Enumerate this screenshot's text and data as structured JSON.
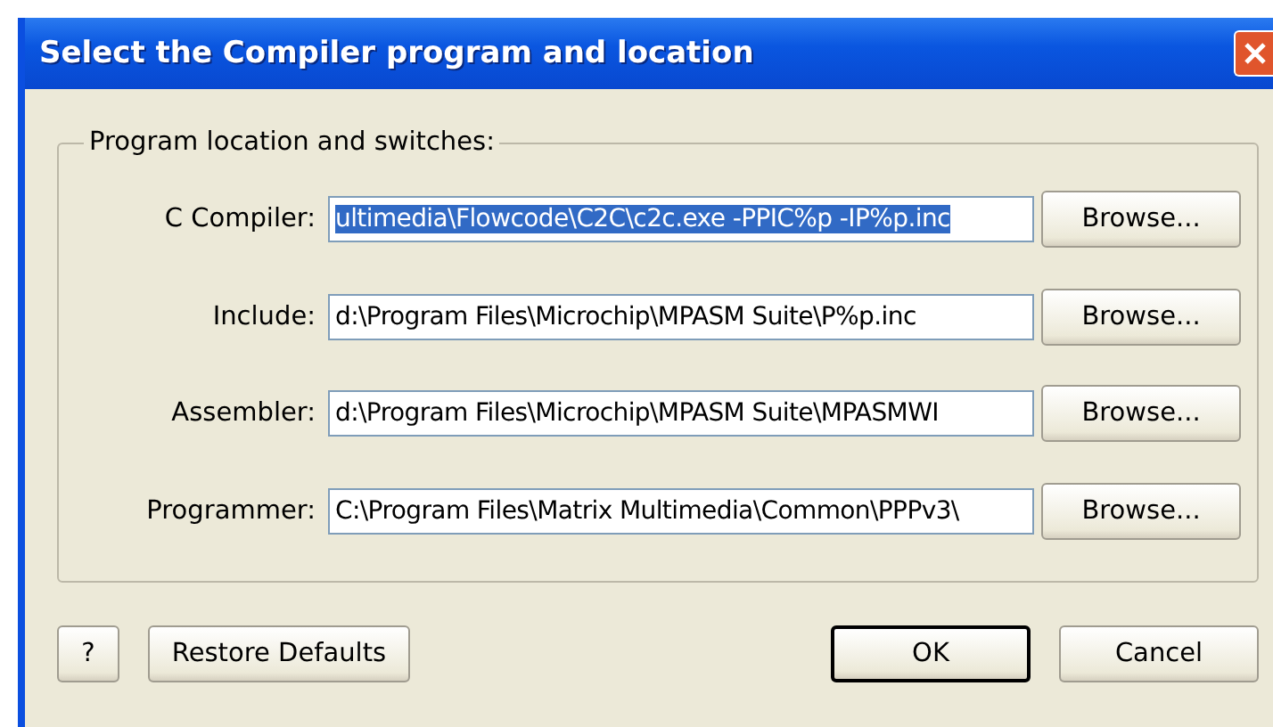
{
  "window": {
    "title": "Select the Compiler program and location"
  },
  "group": {
    "legend": "Program location and switches:"
  },
  "rows": [
    {
      "label": "C Compiler:",
      "value": "ultimedia\\Flowcode\\C2C\\c2c.exe -PPIC%p -IP%p.inc",
      "highlighted": true,
      "button": "Browse..."
    },
    {
      "label": "Include:",
      "value": "d:\\Program Files\\Microchip\\MPASM Suite\\P%p.inc",
      "highlighted": false,
      "button": "Browse..."
    },
    {
      "label": "Assembler:",
      "value": "d:\\Program Files\\Microchip\\MPASM Suite\\MPASMWI",
      "highlighted": false,
      "button": "Browse..."
    },
    {
      "label": "Programmer:",
      "value": "C:\\Program Files\\Matrix Multimedia\\Common\\PPPv3\\",
      "highlighted": false,
      "button": "Browse..."
    }
  ],
  "buttons": [
    {
      "label": "?",
      "kind": "help",
      "default": false
    },
    {
      "label": "Restore Defaults",
      "kind": "restore",
      "default": false
    },
    {
      "label": "OK",
      "kind": "ok",
      "default": true
    },
    {
      "label": "Cancel",
      "kind": "cancel",
      "default": false
    }
  ]
}
